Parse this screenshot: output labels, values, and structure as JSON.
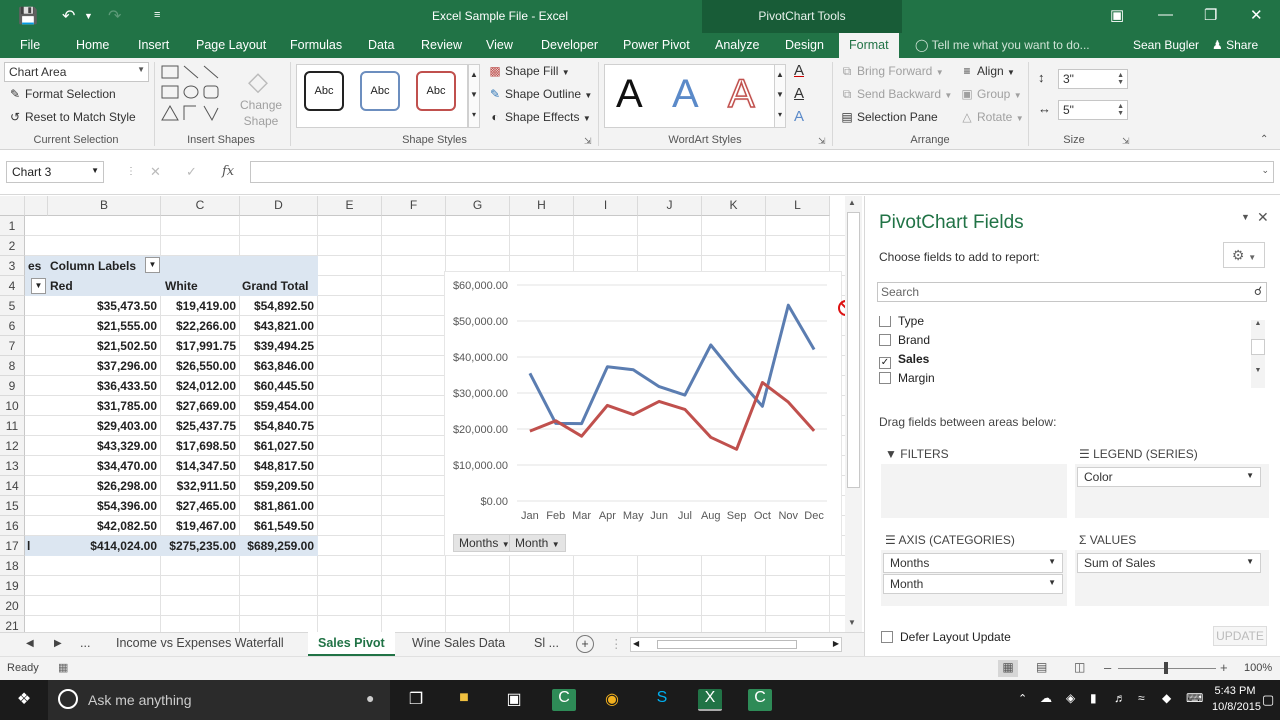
{
  "titlebar": {
    "title": "Excel Sample File - Excel",
    "context_tools": "PivotChart Tools"
  },
  "tabs": {
    "items": [
      "File",
      "Home",
      "Insert",
      "Page Layout",
      "Formulas",
      "Data",
      "Review",
      "View",
      "Developer",
      "Power Pivot",
      "Analyze",
      "Design",
      "Format"
    ],
    "active": "Format",
    "tell_me": "Tell me what you want to do...",
    "user": "Sean Bugler",
    "share": "Share"
  },
  "ribbon": {
    "current_selection": {
      "combo_value": "Chart Area",
      "format_selection": "Format Selection",
      "reset_to_match": "Reset to Match Style",
      "label": "Current Selection"
    },
    "insert_shapes": {
      "change_shape_1": "Change",
      "change_shape_2": "Shape",
      "label": "Insert Shapes"
    },
    "shape_styles": {
      "preset_text": "Abc",
      "shape_fill": "Shape Fill",
      "shape_outline": "Shape Outline",
      "shape_effects": "Shape Effects",
      "label": "Shape Styles"
    },
    "wordart_styles": {
      "letter": "A",
      "label": "WordArt Styles"
    },
    "arrange": {
      "bring_forward": "Bring Forward",
      "send_backward": "Send Backward",
      "selection_pane": "Selection Pane",
      "align": "Align",
      "group": "Group",
      "rotate": "Rotate",
      "label": "Arrange"
    },
    "size": {
      "height": "3\"",
      "width": "5\"",
      "label": "Size"
    }
  },
  "formula_bar": {
    "name_box": "Chart 3",
    "fx": "fx",
    "cancel": "✕",
    "enter": "✓"
  },
  "grid": {
    "columns": [
      "B",
      "C",
      "D",
      "E",
      "F",
      "G",
      "H",
      "I",
      "J",
      "K",
      "L"
    ],
    "rows": [
      "1",
      "2",
      "3",
      "4",
      "5",
      "6",
      "7",
      "8",
      "9",
      "10",
      "11",
      "12",
      "13",
      "14",
      "15",
      "16",
      "17",
      "18",
      "19",
      "20",
      "21"
    ],
    "pivot": {
      "row3_a": "es",
      "column_labels": "Column Labels",
      "headers": [
        "Red",
        "White",
        "Grand Total"
      ],
      "data": [
        [
          "$35,473.50",
          "$19,419.00",
          "$54,892.50"
        ],
        [
          "$21,555.00",
          "$22,266.00",
          "$43,821.00"
        ],
        [
          "$21,502.50",
          "$17,991.75",
          "$39,494.25"
        ],
        [
          "$37,296.00",
          "$26,550.00",
          "$63,846.00"
        ],
        [
          "$36,433.50",
          "$24,012.00",
          "$60,445.50"
        ],
        [
          "$31,785.00",
          "$27,669.00",
          "$59,454.00"
        ],
        [
          "$29,403.00",
          "$25,437.75",
          "$54,840.75"
        ],
        [
          "$43,329.00",
          "$17,698.50",
          "$61,027.50"
        ],
        [
          "$34,470.00",
          "$14,347.50",
          "$48,817.50"
        ],
        [
          "$26,298.00",
          "$32,911.50",
          "$59,209.50"
        ],
        [
          "$54,396.00",
          "$27,465.00",
          "$81,861.00"
        ],
        [
          "$42,082.50",
          "$19,467.00",
          "$61,549.50"
        ]
      ],
      "total_label": "l",
      "totals": [
        "$414,024.00",
        "$275,235.00",
        "$689,259.00"
      ]
    }
  },
  "chart_data": {
    "type": "line",
    "categories": [
      "Jan",
      "Feb",
      "Mar",
      "Apr",
      "May",
      "Jun",
      "Jul",
      "Aug",
      "Sep",
      "Oct",
      "Nov",
      "Dec"
    ],
    "series": [
      {
        "values": [
          35473.5,
          21555,
          21502.5,
          37296,
          36433.5,
          31785,
          29403,
          43329,
          34470,
          26298,
          54396,
          42082.5
        ],
        "color": "#5b7db1"
      },
      {
        "values": [
          19419,
          22266,
          17991.75,
          26550,
          24012,
          27669,
          25437.75,
          17698.5,
          14347.5,
          32911.5,
          27465,
          19467
        ],
        "color": "#c0504d"
      }
    ],
    "yticks": [
      "$0.00",
      "$10,000.00",
      "$20,000.00",
      "$30,000.00",
      "$40,000.00",
      "$50,000.00",
      "$60,000.00"
    ],
    "ylim": [
      0,
      60000
    ],
    "grid": true,
    "field_buttons": [
      "Months",
      "Month"
    ]
  },
  "pane": {
    "title": "PivotChart Fields",
    "choose": "Choose fields to add to report:",
    "search_placeholder": "Search",
    "fields": [
      {
        "label": "Type",
        "checked": false
      },
      {
        "label": "Brand",
        "checked": false
      },
      {
        "label": "Sales",
        "checked": true
      },
      {
        "label": "Margin",
        "checked": false
      }
    ],
    "drag_text": "Drag fields between areas below:",
    "filters": "FILTERS",
    "legend": "LEGEND (SERIES)",
    "legend_items": [
      "Color"
    ],
    "axis": "AXIS (CATEGORIES)",
    "axis_items": [
      "Months",
      "Month"
    ],
    "values": "VALUES",
    "values_items": [
      "Sum of Sales"
    ],
    "defer": "Defer Layout Update",
    "update": "UPDATE"
  },
  "sheet_tabs": {
    "ellipsis": "...",
    "tabs": [
      "Income vs Expenses Waterfall",
      "Sales Pivot",
      "Wine Sales Data",
      "Sl ..."
    ],
    "active": "Sales Pivot"
  },
  "status": {
    "ready": "Ready",
    "zoom": "100%"
  },
  "taskbar": {
    "search": "Ask me anything",
    "time": "5:43 PM",
    "date": "10/8/2015"
  }
}
